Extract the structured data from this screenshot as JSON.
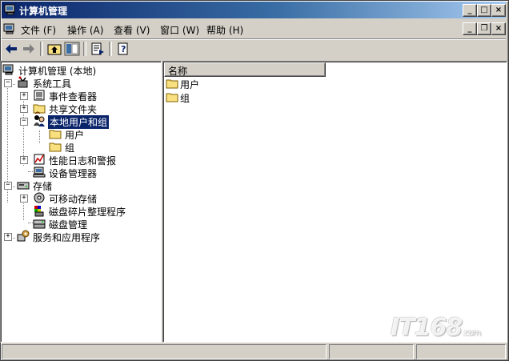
{
  "window": {
    "title": "计算机管理"
  },
  "menu": [
    {
      "label": "文件 (F)"
    },
    {
      "label": "操作 (A)"
    },
    {
      "label": "查看 (V)"
    },
    {
      "label": "窗口 (W)"
    },
    {
      "label": "帮助 (H)"
    }
  ],
  "tree": {
    "root": "计算机管理 (本地)",
    "system_tools": "系统工具",
    "event_viewer": "事件查看器",
    "shared_folders": "共享文件夹",
    "local_users": "本地用户和组",
    "users": "用户",
    "groups": "组",
    "perf_logs": "性能日志和警报",
    "device_manager": "设备管理器",
    "storage": "存储",
    "removable": "可移动存储",
    "defrag": "磁盘碎片整理程序",
    "disk_mgmt": "磁盘管理",
    "services": "服务和应用程序"
  },
  "list": {
    "column_name": "名称",
    "items": [
      "用户",
      "组"
    ]
  },
  "watermark": {
    "brand": "IT168",
    "suffix": ".com"
  }
}
